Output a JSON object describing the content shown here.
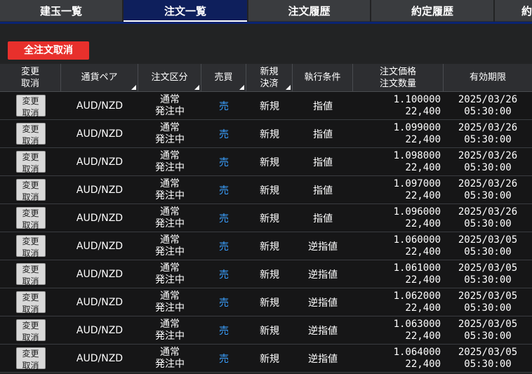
{
  "tabs": [
    {
      "label": "建玉一覧",
      "active": false
    },
    {
      "label": "注文一覧",
      "active": true
    },
    {
      "label": "注文履歴",
      "active": false
    },
    {
      "label": "約定履歴",
      "active": false
    },
    {
      "label": "約",
      "active": false
    }
  ],
  "toolbar": {
    "cancel_all_label": "全注文取消"
  },
  "table": {
    "headers": {
      "modify": [
        "変更",
        "取消"
      ],
      "pair": "通貨ペア",
      "order_type": "注文区分",
      "side": "売買",
      "new_close": [
        "新規",
        "決済"
      ],
      "condition": "執行条件",
      "price_qty": [
        "注文価格",
        "注文数量"
      ],
      "expiry": "有効期限"
    },
    "change_button": [
      "変更",
      "取消"
    ],
    "rows": [
      {
        "pair": "AUD/NZD",
        "type1": "通常",
        "type2": "発注中",
        "side": "売",
        "new_close": "新規",
        "condition": "指値",
        "price": "1.100000",
        "qty": "22,400",
        "date": "2025/03/26",
        "time": "05:30:00"
      },
      {
        "pair": "AUD/NZD",
        "type1": "通常",
        "type2": "発注中",
        "side": "売",
        "new_close": "新規",
        "condition": "指値",
        "price": "1.099000",
        "qty": "22,400",
        "date": "2025/03/26",
        "time": "05:30:00"
      },
      {
        "pair": "AUD/NZD",
        "type1": "通常",
        "type2": "発注中",
        "side": "売",
        "new_close": "新規",
        "condition": "指値",
        "price": "1.098000",
        "qty": "22,400",
        "date": "2025/03/26",
        "time": "05:30:00"
      },
      {
        "pair": "AUD/NZD",
        "type1": "通常",
        "type2": "発注中",
        "side": "売",
        "new_close": "新規",
        "condition": "指値",
        "price": "1.097000",
        "qty": "22,400",
        "date": "2025/03/26",
        "time": "05:30:00"
      },
      {
        "pair": "AUD/NZD",
        "type1": "通常",
        "type2": "発注中",
        "side": "売",
        "new_close": "新規",
        "condition": "指値",
        "price": "1.096000",
        "qty": "22,400",
        "date": "2025/03/26",
        "time": "05:30:00"
      },
      {
        "pair": "AUD/NZD",
        "type1": "通常",
        "type2": "発注中",
        "side": "売",
        "new_close": "新規",
        "condition": "逆指値",
        "price": "1.060000",
        "qty": "22,400",
        "date": "2025/03/05",
        "time": "05:30:00"
      },
      {
        "pair": "AUD/NZD",
        "type1": "通常",
        "type2": "発注中",
        "side": "売",
        "new_close": "新規",
        "condition": "逆指値",
        "price": "1.061000",
        "qty": "22,400",
        "date": "2025/03/05",
        "time": "05:30:00"
      },
      {
        "pair": "AUD/NZD",
        "type1": "通常",
        "type2": "発注中",
        "side": "売",
        "new_close": "新規",
        "condition": "逆指値",
        "price": "1.062000",
        "qty": "22,400",
        "date": "2025/03/05",
        "time": "05:30:00"
      },
      {
        "pair": "AUD/NZD",
        "type1": "通常",
        "type2": "発注中",
        "side": "売",
        "new_close": "新規",
        "condition": "逆指値",
        "price": "1.063000",
        "qty": "22,400",
        "date": "2025/03/05",
        "time": "05:30:00"
      },
      {
        "pair": "AUD/NZD",
        "type1": "通常",
        "type2": "発注中",
        "side": "売",
        "new_close": "新規",
        "condition": "逆指値",
        "price": "1.064000",
        "qty": "22,400",
        "date": "2025/03/05",
        "time": "05:30:00"
      }
    ]
  },
  "colors": {
    "accent_red": "#e8302c",
    "sell_blue": "#3aa0ff",
    "active_tab": "#0e1f5c"
  }
}
